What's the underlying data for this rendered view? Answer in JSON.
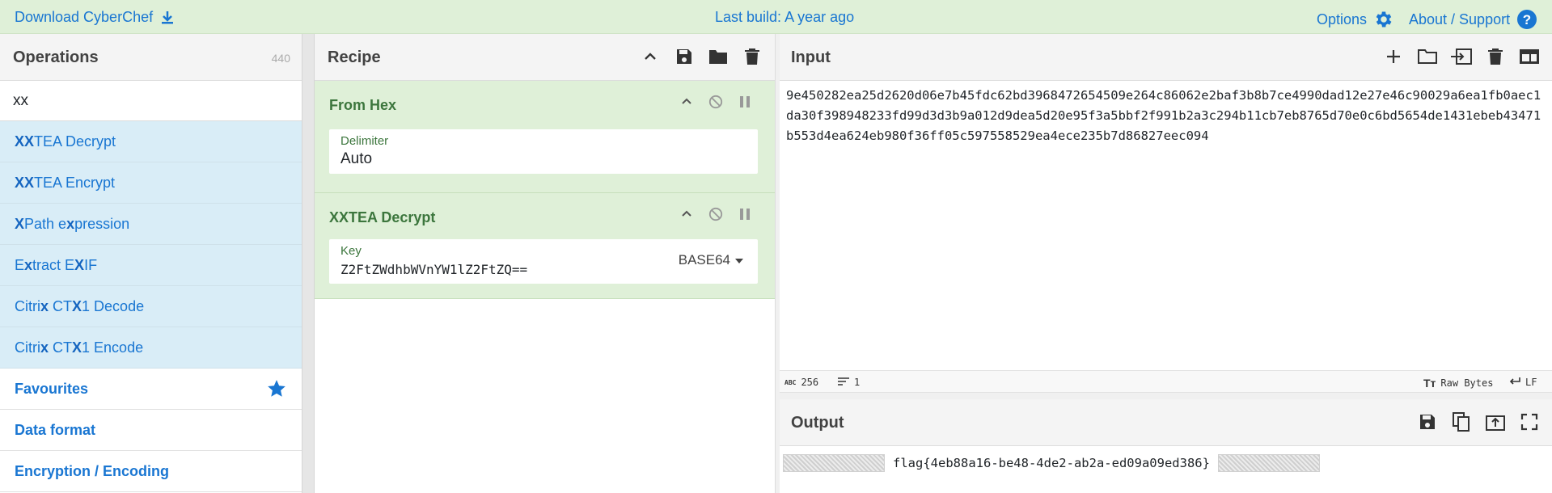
{
  "banner": {
    "download_label": "Download CyberChef",
    "last_build": "Last build: A year ago",
    "options_label": "Options",
    "about_label": "About / Support"
  },
  "operations": {
    "title": "Operations",
    "count": "440",
    "search_value": "xx",
    "results": [
      {
        "pre": "",
        "match": "XX",
        "post": "TEA Decrypt"
      },
      {
        "pre": "",
        "match": "XX",
        "post": "TEA Encrypt"
      },
      {
        "pre": "",
        "match": "X",
        "post": "Path e",
        "match2": "x",
        "post2": "pression"
      },
      {
        "pre": "E",
        "match": "x",
        "post": "tract E",
        "match2": "X",
        "post2": "IF"
      },
      {
        "pre": "Citri",
        "match": "x",
        "post": " CT",
        "match2": "X",
        "post2": "1 Decode"
      },
      {
        "pre": "Citri",
        "match": "x",
        "post": " CT",
        "match2": "X",
        "post2": "1 Encode"
      }
    ],
    "categories": [
      "Favourites",
      "Data format",
      "Encryption / Encoding"
    ]
  },
  "recipe": {
    "title": "Recipe",
    "ops": [
      {
        "name": "From Hex",
        "field_label": "Delimiter",
        "field_value": "Auto"
      },
      {
        "name": "XXTEA Decrypt",
        "field_label": "Key",
        "field_value": "Z2FtZWdhbWVnYW1lZ2FtZQ==",
        "encoding": "BASE64"
      }
    ]
  },
  "input": {
    "title": "Input",
    "text": "9e450282ea25d2620d06e7b45fdc62bd3968472654509e264c86062e2baf3b8b7ce4990dad12e27e46c90029a6ea1fb0aec1da30f398948233fd99d3d3b9a012d9dea5d20e95f3a5bbf2f991b2a3c294b11cb7eb8765d70e0c6bd5654de1431ebeb43471b553d4ea624eb980f36ff05c597558529ea4ece235b7d86827eec094",
    "length": "256",
    "lines": "1",
    "abc_label": "ABC",
    "encoding": "Raw Bytes",
    "eol": "LF"
  },
  "output": {
    "title": "Output",
    "text": "flag{4eb88a16-be48-4de2-ab2a-ed09a09ed386}"
  },
  "colors": {
    "accent": "#1976d2",
    "banner_bg": "#dff0d8",
    "recipe_green": "#3c763d",
    "search_result_bg": "#d9edf7"
  }
}
